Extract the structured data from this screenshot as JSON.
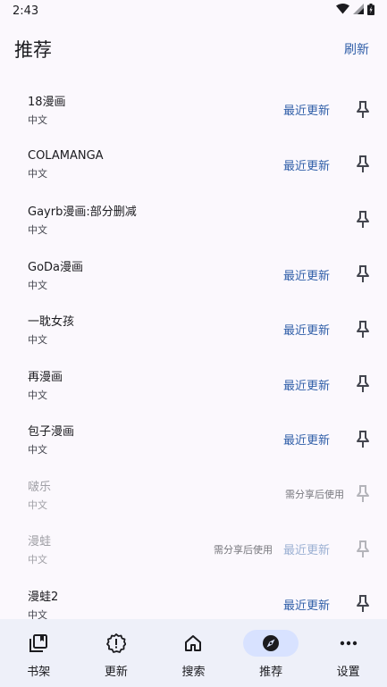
{
  "status": {
    "time": "2:43"
  },
  "app": {
    "title": "推荐",
    "refresh_label": "刷新"
  },
  "sources": [
    {
      "name": "18漫画",
      "lang": "中文",
      "note": "",
      "update_label": "最近更新",
      "disabled": false
    },
    {
      "name": "COLAMANGA",
      "lang": "中文",
      "note": "",
      "update_label": "最近更新",
      "disabled": false
    },
    {
      "name": "Gayrb漫画:部分删减",
      "lang": "中文",
      "note": "",
      "update_label": "",
      "disabled": false
    },
    {
      "name": "GoDa漫画",
      "lang": "中文",
      "note": "",
      "update_label": "最近更新",
      "disabled": false
    },
    {
      "name": "一耽女孩",
      "lang": "中文",
      "note": "",
      "update_label": "最近更新",
      "disabled": false
    },
    {
      "name": "再漫画",
      "lang": "中文",
      "note": "",
      "update_label": "最近更新",
      "disabled": false
    },
    {
      "name": "包子漫画",
      "lang": "中文",
      "note": "",
      "update_label": "最近更新",
      "disabled": false
    },
    {
      "name": "啵乐",
      "lang": "中文",
      "note": "需分享后使用",
      "update_label": "",
      "disabled": true
    },
    {
      "name": "漫蛙",
      "lang": "中文",
      "note": "需分享后使用",
      "update_label": "最近更新",
      "disabled": true
    },
    {
      "name": "漫蛙2",
      "lang": "中文",
      "note": "",
      "update_label": "最近更新",
      "disabled": false
    }
  ],
  "nav": [
    {
      "label": "书架",
      "icon": "bookshelf-icon",
      "active": false
    },
    {
      "label": "更新",
      "icon": "updates-alert-icon",
      "active": false
    },
    {
      "label": "搜索",
      "icon": "home-icon",
      "active": false
    },
    {
      "label": "推荐",
      "icon": "compass-icon",
      "active": true
    },
    {
      "label": "设置",
      "icon": "more-dots-icon",
      "active": false
    }
  ],
  "colors": {
    "accent": "#2f5ea8",
    "nav_bg": "#eef0f9",
    "nav_active": "#d8e2ff",
    "background": "#fbf8fd"
  }
}
